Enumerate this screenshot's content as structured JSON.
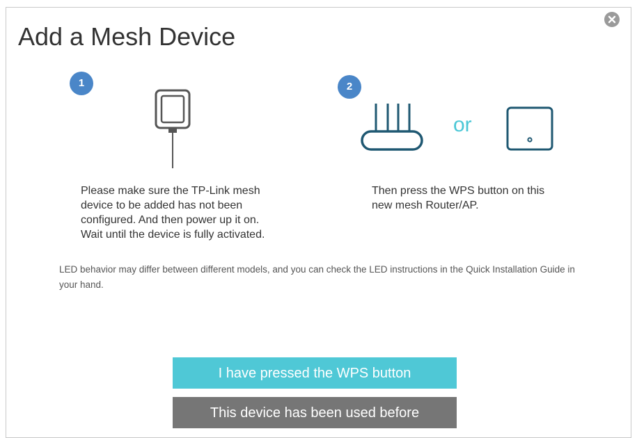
{
  "dialog": {
    "title": "Add a Mesh Device",
    "close_icon": "close-circle-icon"
  },
  "steps": [
    {
      "number": "1",
      "illustration": "power-adapter-icon",
      "text": "Please make sure the TP-Link mesh\ndevice to be added has not been\nconfigured. And then power up it on.\nWait until the device is fully activated."
    },
    {
      "number": "2",
      "illustration_a": "router-icon",
      "separator": "or",
      "illustration_b": "mesh-ap-icon",
      "text": "Then press the WPS button on this\nnew mesh Router/AP."
    }
  ],
  "note": "LED behavior may differ between different models, and you can check the LED instructions in the Quick Installation Guide in your hand.",
  "buttons": {
    "primary_label": "I have pressed the WPS button",
    "secondary_label": "This device has been used before"
  },
  "colors": {
    "accent": "#4fc8d6",
    "badge": "#4a86c8",
    "secondary_button": "#767676"
  }
}
